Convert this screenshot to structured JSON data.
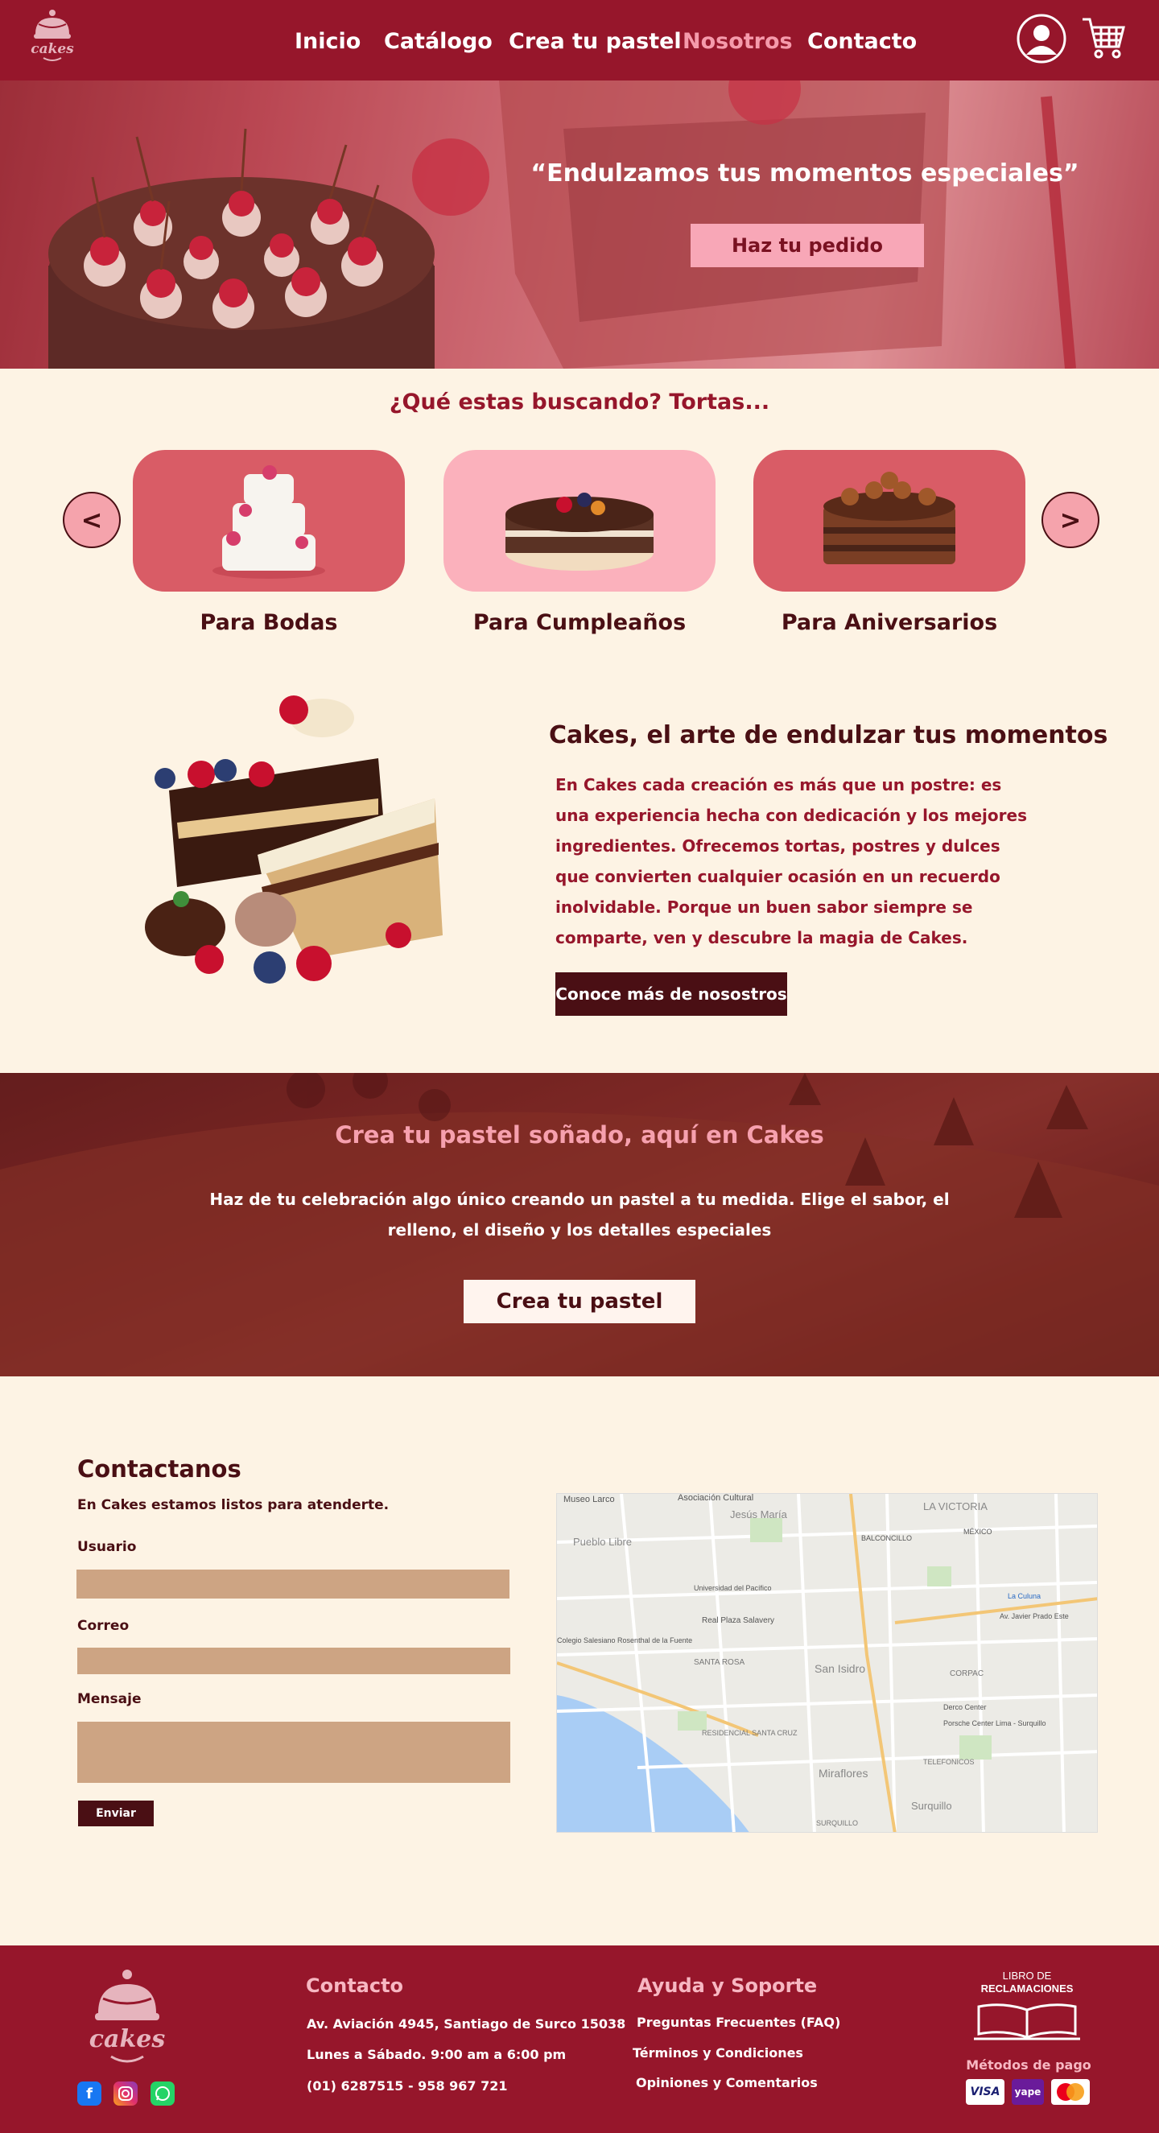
{
  "header": {
    "logo_text": "cakes",
    "nav": [
      {
        "label": "Inicio"
      },
      {
        "label": "Catálogo"
      },
      {
        "label": "Crea tu pastel"
      },
      {
        "label": "Nosotros"
      },
      {
        "label": "Contacto"
      }
    ],
    "active_nav": "Nosotros"
  },
  "hero": {
    "quote": "“Endulzamos tus  momentos especiales”",
    "button": "Haz tu pedido"
  },
  "categories": {
    "heading": "¿Qué estas buscando? Tortas...",
    "prev": "<",
    "next": ">",
    "items": [
      {
        "label": "Para Bodas"
      },
      {
        "label": "Para Cumpleaños"
      },
      {
        "label": "Para Aniversarios"
      }
    ]
  },
  "about": {
    "title": "Cakes, el arte de endulzar tus momentos",
    "text": "En Cakes cada creación es más que un postre: es una experiencia hecha con dedicación y los mejores ingredientes. Ofrecemos tortas, postres y dulces que convierten cualquier ocasión en un recuerdo inolvidable. Porque un buen sabor siempre se comparte, ven y descubre la magia de Cakes.",
    "button": "Conoce más de nosostros"
  },
  "create": {
    "title": "Crea tu pastel soñado, aquí en Cakes",
    "text": "Haz de tu celebración algo único creando un pastel a tu medida. Elige el sabor, el relleno, el diseño y los detalles especiales",
    "button": "Crea tu pastel"
  },
  "contact": {
    "title": "Contactanos",
    "subtitle": "En Cakes estamos listos para atenderte.",
    "user_label": "Usuario",
    "email_label": "Correo",
    "message_label": "Mensaje",
    "send": "Enviar",
    "map_labels": [
      "Museo Larco",
      "Asociación Cultural",
      "Jesús María",
      "Pueblo Libre",
      "LA VICTORIA",
      "BALCONCILLO",
      "MÉXICO",
      "Universidad del Pacífico",
      "Real Plaza Salavery",
      "Colegio Salesiano Rosenthal de la Fuente",
      "SANTA ROSA",
      "San Isidro",
      "CORPAC",
      "Derco Center",
      "Porsche Center Lima - Surquillo",
      "RESIDENCIAL SANTA CRUZ",
      "Miraflores",
      "TELEFONICOS",
      "Surquillo",
      "SURQUILLO",
      "La Culuna",
      "Av. Javier Prado Este"
    ]
  },
  "footer": {
    "logo_text": "cakes",
    "contact_head": "Contacto",
    "contact": [
      "Av. Aviación 4945, Santiago de Surco 15038",
      "Lunes a Sábado. 9:00 am a 6:00 pm",
      "(01) 6287515 - 958 967 721"
    ],
    "help_head": "Ayuda y Soporte",
    "help": [
      "Preguntas Frecuentes (FAQ)",
      "Términos y Condiciones",
      "Opiniones y Comentarios"
    ],
    "claims_line1": "LIBRO DE",
    "claims_line2": "RECLAMACIONES",
    "payments_head": "Métodos de pago",
    "payments": [
      "VISA",
      "yape",
      "mastercard"
    ],
    "social": [
      "facebook-icon",
      "instagram-icon",
      "whatsapp-icon"
    ]
  },
  "colors": {
    "primary": "#96162b",
    "dark": "#4a0f14",
    "pink": "#f8a7b7",
    "cream": "#fdf3e4",
    "field": "#cda483"
  }
}
